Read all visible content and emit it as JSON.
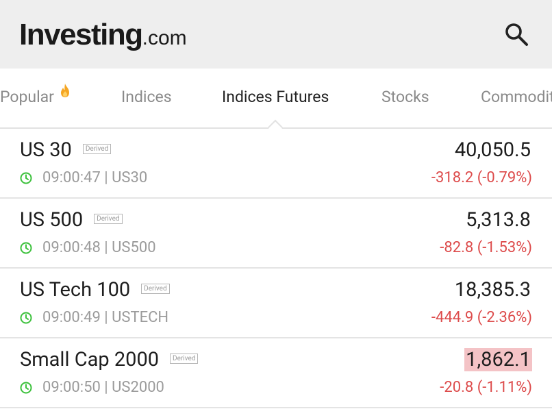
{
  "header": {
    "logo_main": "Investing",
    "logo_suffix": ".com",
    "search_icon": "search-icon"
  },
  "tabs": [
    {
      "label": "Popular",
      "icon": "fire-icon",
      "active": false
    },
    {
      "label": "Indices",
      "active": false
    },
    {
      "label": "Indices Futures",
      "active": true
    },
    {
      "label": "Stocks",
      "active": false
    },
    {
      "label": "Commodit",
      "active": false
    }
  ],
  "rows": [
    {
      "name": "US 30",
      "badge": "Derived",
      "time": "09:00:47",
      "symbol": "US30",
      "price": "40,050.5",
      "change": "-318.2 (-0.79%)",
      "highlight": false
    },
    {
      "name": "US 500",
      "badge": "Derived",
      "time": "09:00:48",
      "symbol": "US500",
      "price": "5,313.8",
      "change": "-82.8 (-1.53%)",
      "highlight": false
    },
    {
      "name": "US Tech 100",
      "badge": "Derived",
      "time": "09:00:49",
      "symbol": "USTECH",
      "price": "18,385.3",
      "change": "-444.9 (-2.36%)",
      "highlight": false
    },
    {
      "name": "Small Cap 2000",
      "badge": "Derived",
      "time": "09:00:50",
      "symbol": "US2000",
      "price": "1,862.1",
      "change": "-20.8 (-1.11%)",
      "highlight": true
    }
  ],
  "colors": {
    "negative": "#dd4b4b",
    "clock": "#3cc13c",
    "fire": "#f5a623",
    "price_highlight": "#f4c3c6"
  }
}
